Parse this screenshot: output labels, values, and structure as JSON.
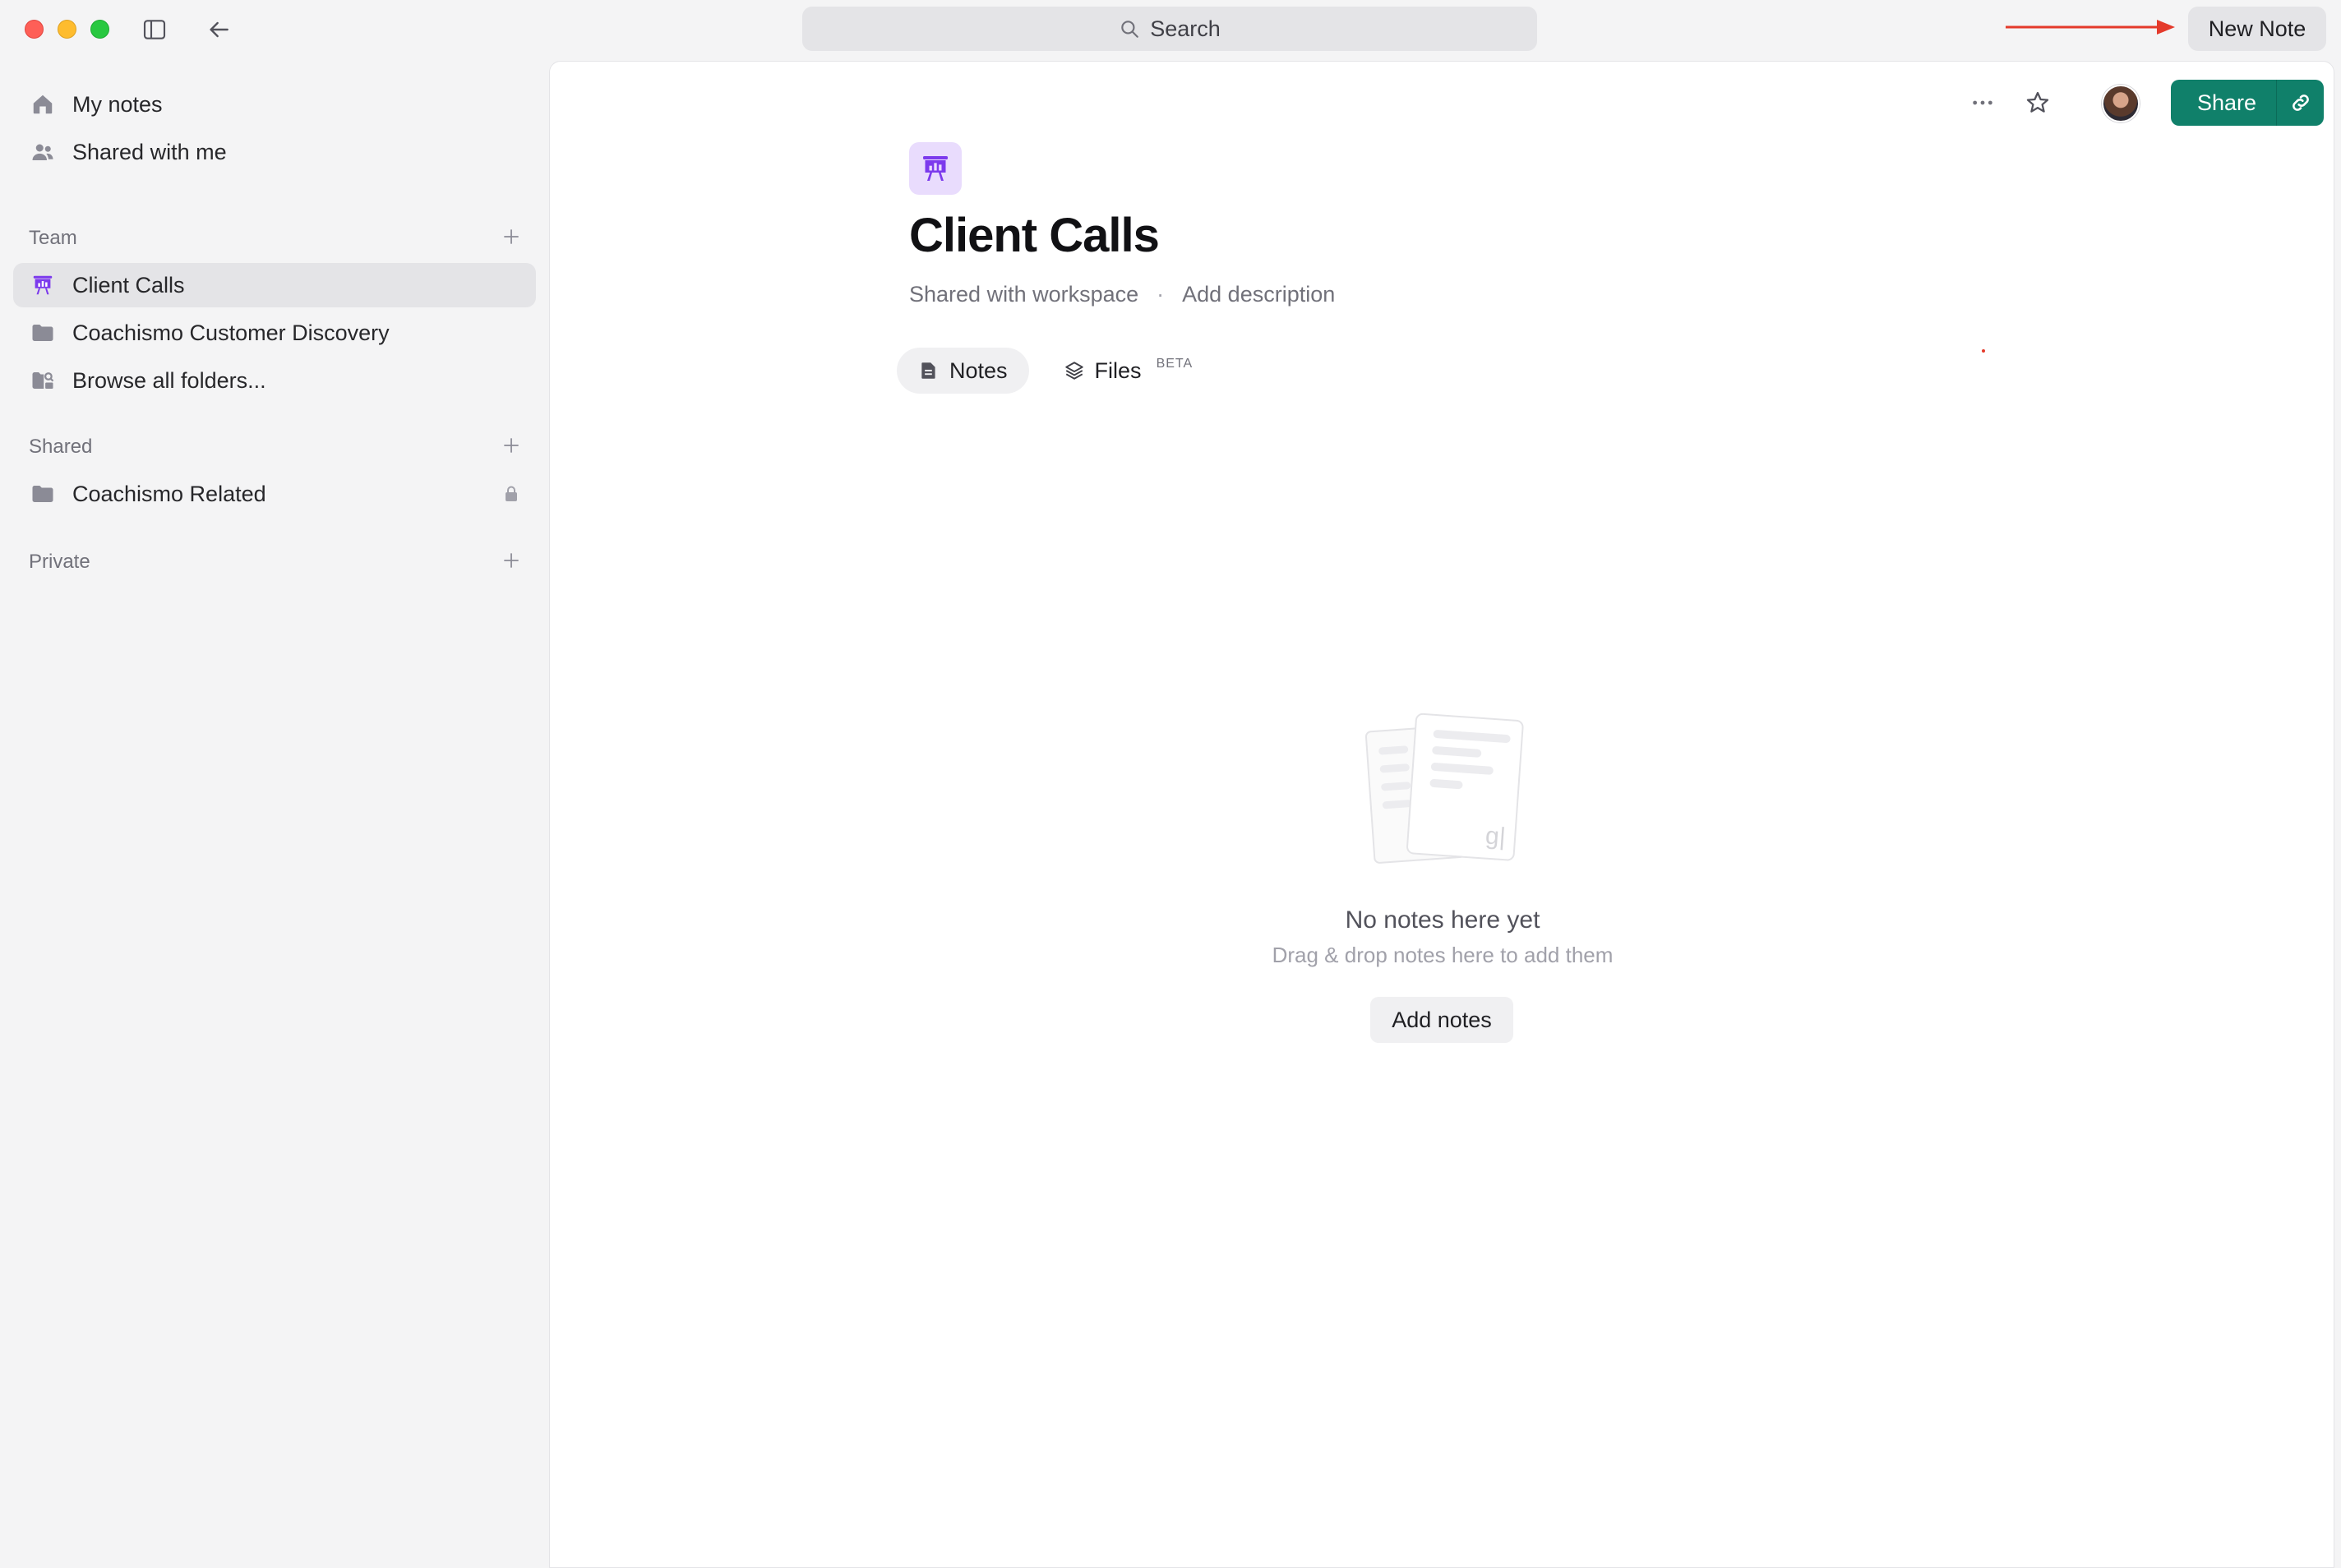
{
  "titlebar": {
    "search_label": "Search",
    "new_note_label": "New Note"
  },
  "sidebar": {
    "top_items": [
      {
        "label": "My notes",
        "icon": "home-icon"
      },
      {
        "label": "Shared with me",
        "icon": "people-icon"
      }
    ],
    "sections": {
      "team": {
        "label": "Team",
        "items": [
          {
            "label": "Client Calls",
            "icon": "presentation-icon",
            "active": true
          },
          {
            "label": "Coachismo Customer Discovery",
            "icon": "folder-icon"
          },
          {
            "label": "Browse all folders...",
            "icon": "browse-folders-icon"
          }
        ]
      },
      "shared": {
        "label": "Shared",
        "items": [
          {
            "label": "Coachismo Related",
            "icon": "folder-icon",
            "locked": true
          }
        ]
      },
      "private": {
        "label": "Private",
        "items": []
      }
    }
  },
  "main": {
    "title": "Client Calls",
    "shared_status": "Shared with workspace",
    "separator": "·",
    "add_description": "Add description",
    "share_label": "Share",
    "tabs": [
      {
        "label": "Notes",
        "active": true
      },
      {
        "label": "Files",
        "badge": "BETA"
      }
    ],
    "empty_state": {
      "title": "No notes here yet",
      "subtitle": "Drag & drop notes here to add them",
      "button_label": "Add notes"
    }
  },
  "colors": {
    "accent_green": "#10806a",
    "accent_purple": "#7c3aed",
    "arrow_red": "#e43a2b"
  }
}
